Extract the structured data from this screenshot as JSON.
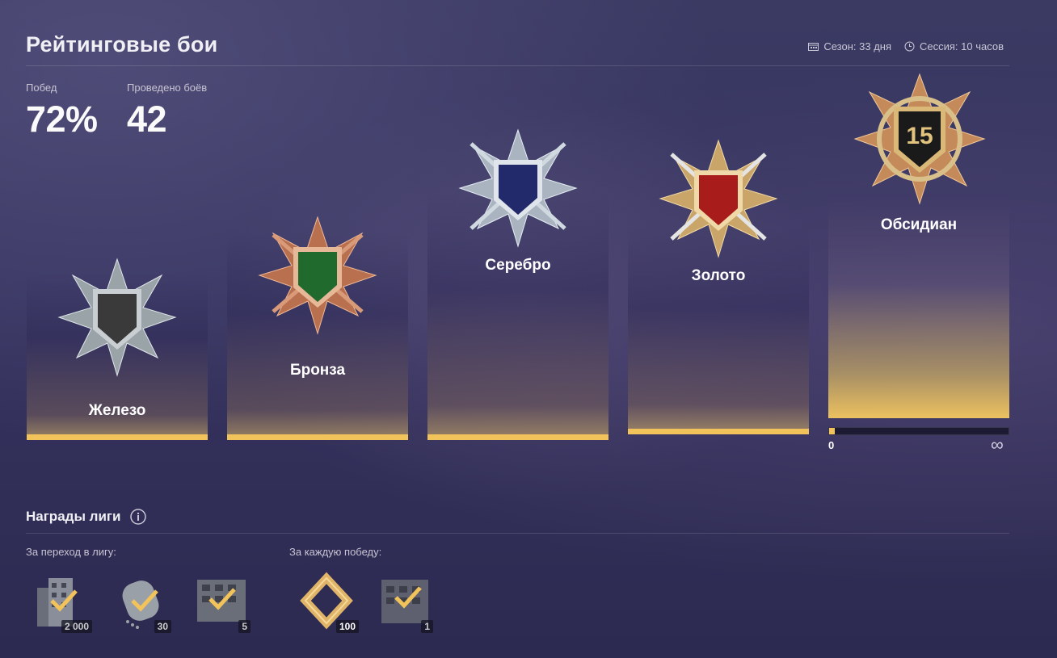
{
  "header": {
    "title": "Рейтинговые бои",
    "season_label": "Сезон: 33 дня",
    "session_label": "Сессия: 10 часов"
  },
  "stats": {
    "wins_label": "Побед",
    "wins_value": "72%",
    "battles_label": "Проведено боёв",
    "battles_value": "42"
  },
  "leagues": [
    {
      "name": "Железо",
      "shield_color": "#3a3a3a",
      "progress": 1
    },
    {
      "name": "Бронза",
      "shield_color": "#1f6a2c",
      "progress": 1
    },
    {
      "name": "Серебро",
      "shield_color": "#222a6b",
      "progress": 1
    },
    {
      "name": "Золото",
      "shield_color": "#a81c1c",
      "progress": 1
    },
    {
      "name": "Обсидиан",
      "shield_color": "#1a1a1a",
      "rank": "15",
      "progress": 0.03,
      "progress_min": "0",
      "progress_max": "∞"
    }
  ],
  "rewards": {
    "title": "Награды лиги",
    "promotion_label": "За переход в лигу:",
    "per_win_label": "За каждую победу:",
    "promotion_items": [
      {
        "icon": "bonds-building-icon",
        "count": "2 000"
      },
      {
        "icon": "dog-tag-icon",
        "count": "30"
      },
      {
        "icon": "container-building-icon",
        "count": "5"
      }
    ],
    "win_items": [
      {
        "icon": "gold-diamond-icon",
        "count": "100"
      },
      {
        "icon": "crate-icon",
        "count": "1"
      }
    ]
  },
  "colors": {
    "accent": "#f2c35a",
    "background": "#363460"
  }
}
